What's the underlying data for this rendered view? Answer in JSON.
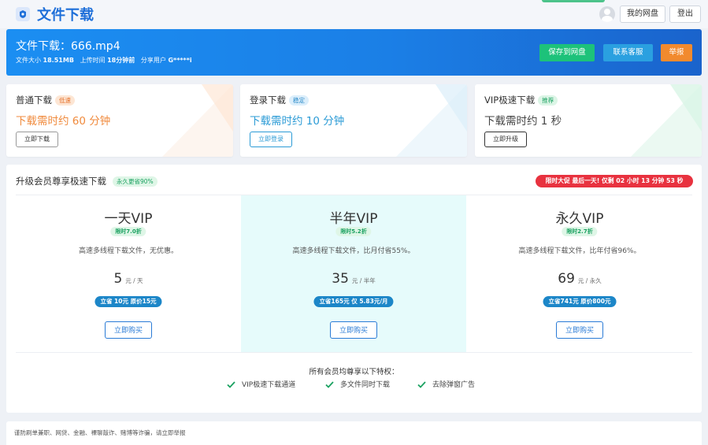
{
  "header": {
    "site_title": "文件下载",
    "my_drive_label": "我的网盘",
    "logout_label": "登出"
  },
  "file": {
    "title": "文件下载：666.mp4",
    "size_label": "文件大小",
    "size_value": "18.51MB",
    "upload_label": "上传时间",
    "upload_value": "18分钟前",
    "share_label": "分享用户",
    "share_value": "G*****i",
    "buttons": {
      "save": "保存到网盘",
      "contact": "联系客服",
      "report": "举报"
    }
  },
  "download_options": [
    {
      "title": "普通下载",
      "tag": "低速",
      "time": "下载需时约 60 分钟",
      "button": "立即下载"
    },
    {
      "title": "登录下载",
      "tag": "稳定",
      "time": "下载需时约 10 分钟",
      "button": "立即登录"
    },
    {
      "title": "VIP极速下载",
      "tag": "推荐",
      "time": "下载需时约 1 秒",
      "button": "立即升级"
    }
  ],
  "upgrade": {
    "title": "升级会员尊享极速下载",
    "title_tag": "永久更省90%",
    "promo": "限时大促 最后一天! 仅剩 02 小时 13 分钟 53 秒",
    "plans": [
      {
        "name": "一天VIP",
        "discount": "限时7.0折",
        "desc": "高速多线程下载文件，无优惠。",
        "price": "5",
        "unit": "元 / 天",
        "save": "立省 10元 原价15元",
        "button": "立即购买"
      },
      {
        "name": "半年VIP",
        "discount": "限时5.2折",
        "desc": "高速多线程下载文件，比月付省55%。",
        "price": "35",
        "unit": "元 / 半年",
        "save": "立省165元 仅 5.83元/月",
        "button": "立即购买"
      },
      {
        "name": "永久VIP",
        "discount": "限时2.7折",
        "desc": "高速多线程下载文件，比年付省96%。",
        "price": "69",
        "unit": "元 / 永久",
        "save": "立省741元 原价800元",
        "button": "立即购买"
      }
    ],
    "perks_title": "所有会员均尊享以下特权：",
    "perks": [
      "VIP极速下载通道",
      "多文件同时下载",
      "去除弹窗广告"
    ]
  },
  "footer": {
    "notice": "谨防刷单兼职、网贷、金融、裸聊敲诈、赌博等诈骗，请立即举报"
  },
  "colors": {
    "brand_blue": "#1b7fe6",
    "save_green": "#1dc27a",
    "contact_blue": "#2aa0e0",
    "report_orange": "#f28a2e",
    "promo_red": "#e8323f",
    "slow_orange": "#f08a3c",
    "login_blue": "#2b9bd6"
  }
}
